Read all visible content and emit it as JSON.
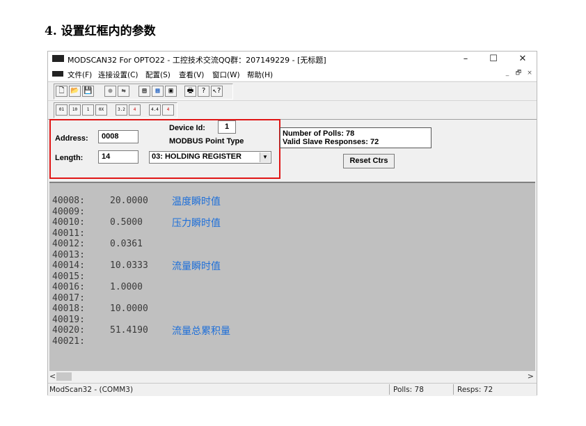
{
  "heading": "4. 设置红框内的参数",
  "window": {
    "title": "MODSCAN32 For OPTO22 - 工控技术交流QQ群：207149229 - [无标题]",
    "controls": [
      "–",
      "☐",
      "✕"
    ]
  },
  "menu": {
    "items": [
      "文件(F)",
      "连接设置(C)",
      "配置(S)",
      "查看(V)",
      "窗口(W)",
      "帮助(H)"
    ],
    "mdi_controls": [
      "_",
      "🗗",
      "×"
    ]
  },
  "toolbar2_labels": [
    "01",
    "10",
    "1",
    "0X",
    "3.2",
    "4",
    "4.4",
    "4"
  ],
  "config": {
    "address_label": "Address:",
    "address_value": "0008",
    "device_id_label": "Device Id:",
    "device_id_value": "1",
    "point_type_label": "MODBUS Point Type",
    "length_label": "Length:",
    "length_value": "14",
    "point_type_value": "03: HOLDING REGISTER"
  },
  "stats": {
    "polls": "Number of Polls: 78",
    "responses": "Valid Slave Responses: 72",
    "reset_label": "Reset Ctrs"
  },
  "rows": [
    {
      "addr": "40008:",
      "val": "20.0000",
      "note": "温度瞬时值"
    },
    {
      "addr": "40009:",
      "val": "",
      "note": ""
    },
    {
      "addr": "40010:",
      "val": "0.5000",
      "note": "压力瞬时值"
    },
    {
      "addr": "40011:",
      "val": "",
      "note": ""
    },
    {
      "addr": "40012:",
      "val": "0.0361",
      "note": ""
    },
    {
      "addr": "40013:",
      "val": "",
      "note": ""
    },
    {
      "addr": "40014:",
      "val": "10.0333",
      "note": "流量瞬时值"
    },
    {
      "addr": "40015:",
      "val": "",
      "note": ""
    },
    {
      "addr": "40016:",
      "val": "1.0000",
      "note": ""
    },
    {
      "addr": "40017:",
      "val": "",
      "note": ""
    },
    {
      "addr": "40018:",
      "val": "10.0000",
      "note": ""
    },
    {
      "addr": "40019:",
      "val": "",
      "note": ""
    },
    {
      "addr": "40020:",
      "val": "51.4190",
      "note": "流量总累积量"
    },
    {
      "addr": "40021:",
      "val": "",
      "note": ""
    }
  ],
  "status": {
    "left": "ModScan32 - (COMM3)",
    "polls": "Polls: 78",
    "resps": "Resps: 72"
  },
  "colors": {
    "highlight_box": "#e01515",
    "annotation": "#1e6fd9",
    "data_bg": "#c0c0c0"
  }
}
